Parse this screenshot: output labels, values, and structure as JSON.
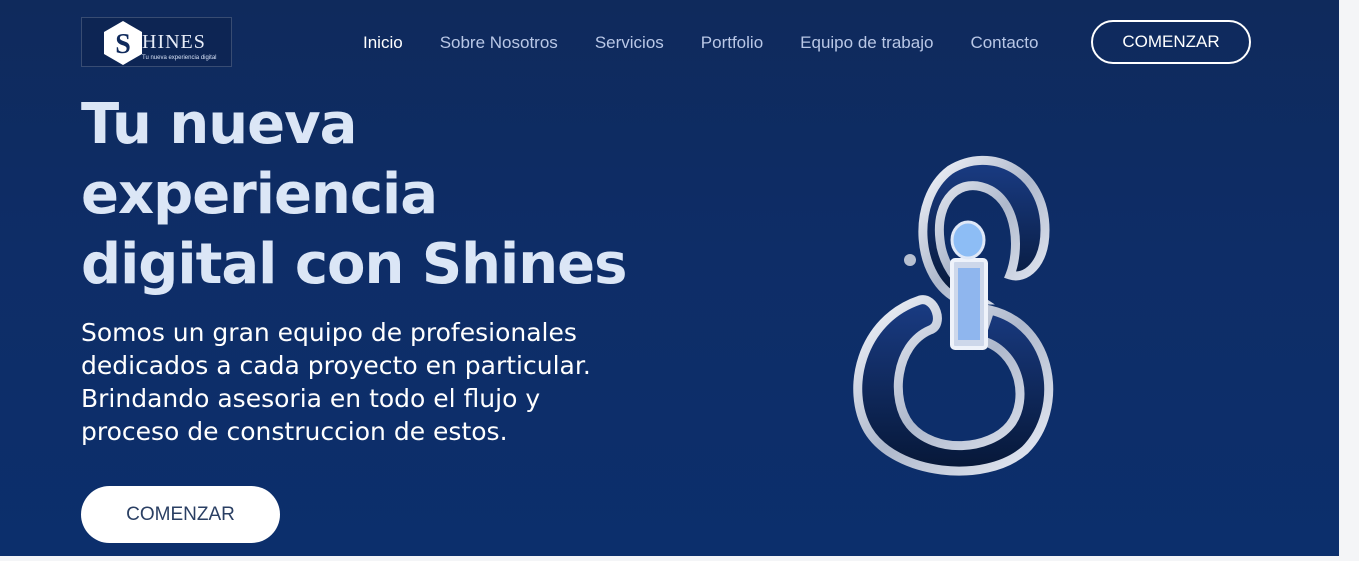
{
  "logo": {
    "letter": "S",
    "word": "HINES",
    "tagline": "Tu nueva experiencia digital"
  },
  "nav": {
    "items": [
      {
        "label": "Inicio",
        "active": true
      },
      {
        "label": "Sobre Nosotros",
        "active": false
      },
      {
        "label": "Servicios",
        "active": false
      },
      {
        "label": "Portfolio",
        "active": false
      },
      {
        "label": "Equipo de trabajo",
        "active": false
      },
      {
        "label": "Contacto",
        "active": false
      }
    ],
    "cta_label": "COMENZAR"
  },
  "hero": {
    "headline_line1": "Tu nueva",
    "headline_line2": "experiencia",
    "headline_line3": "digital con Shines",
    "sub_line1": "Somos un gran equipo de profesionales",
    "sub_line2": "dedicados a cada proyecto en particular.",
    "sub_line3": "Brindando asesoria en todo el flujo y",
    "sub_line4": "proceso de construccion de estos.",
    "cta_label": "COMENZAR"
  },
  "colors": {
    "background": "#0e2d67",
    "headline": "#dbe6f6",
    "nav_text": "#b9c7e6",
    "button_text": "#2a3f63"
  },
  "icons": {
    "hero_graphic": "si-3d-logo-icon"
  }
}
